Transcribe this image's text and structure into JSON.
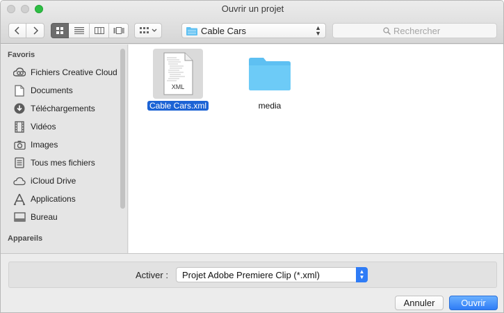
{
  "window": {
    "title": "Ouvrir un projet"
  },
  "toolbar": {
    "path": "Cable Cars",
    "search_placeholder": "Rechercher"
  },
  "sidebar": {
    "favorites_heading": "Favoris",
    "items": [
      {
        "label": "Fichiers Creative Cloud",
        "icon": "creative-cloud-icon"
      },
      {
        "label": "Documents",
        "icon": "documents-icon"
      },
      {
        "label": "Téléchargements",
        "icon": "downloads-icon"
      },
      {
        "label": "Vidéos",
        "icon": "movies-icon"
      },
      {
        "label": "Images",
        "icon": "camera-icon"
      },
      {
        "label": "Tous mes fichiers",
        "icon": "all-files-icon"
      },
      {
        "label": "iCloud Drive",
        "icon": "cloud-icon"
      },
      {
        "label": "Applications",
        "icon": "applications-icon"
      },
      {
        "label": "Bureau",
        "icon": "desktop-icon"
      }
    ],
    "devices_heading": "Appareils"
  },
  "files": [
    {
      "name": "Cable Cars.xml",
      "type": "xml",
      "badge": "XML",
      "selected": true
    },
    {
      "name": "media",
      "type": "folder",
      "selected": false
    }
  ],
  "footer": {
    "format_label": "Activer :",
    "format_value": "Projet Adobe Premiere Clip (*.xml)",
    "cancel_label": "Annuler",
    "open_label": "Ouvrir"
  },
  "colors": {
    "accent": "#2f7cf6",
    "selection": "#1c63d5",
    "folder": "#5ec0f2"
  }
}
